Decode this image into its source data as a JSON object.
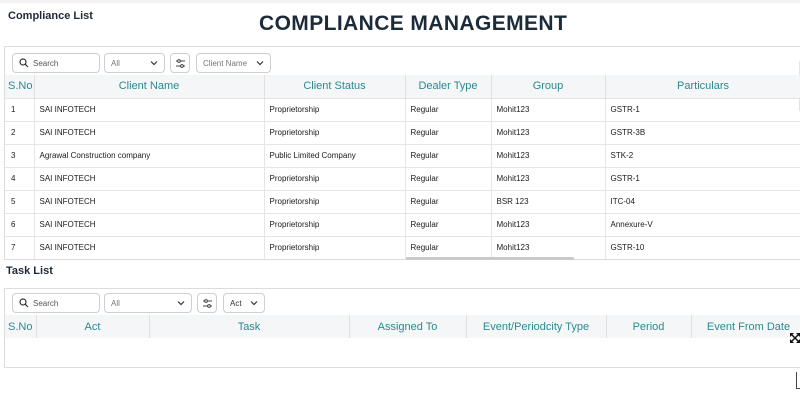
{
  "compliance": {
    "title": "Compliance List",
    "search_placeholder": "Search",
    "filter_all": "All",
    "client_filter": "Client Name",
    "columns": [
      "S.No",
      "Client Name",
      "Client Status",
      "Dealer Type",
      "Group",
      "Particulars"
    ],
    "rows": [
      [
        "1",
        "SAI INFOTECH",
        "Proprietorship",
        "Regular",
        "Mohit123",
        "GSTR-1"
      ],
      [
        "2",
        "SAI INFOTECH",
        "Proprietorship",
        "Regular",
        "Mohit123",
        "GSTR-3B"
      ],
      [
        "3",
        "Agrawal Construction company",
        "Public Limited Company",
        "Regular",
        "Mohit123",
        "STK-2"
      ],
      [
        "4",
        "SAI INFOTECH",
        "Proprietorship",
        "Regular",
        "Mohit123",
        "GSTR-1"
      ],
      [
        "5",
        "SAI INFOTECH",
        "Proprietorship",
        "Regular",
        "BSR 123",
        "ITC-04"
      ],
      [
        "6",
        "SAI INFOTECH",
        "Proprietorship",
        "Regular",
        "Mohit123",
        "Annexure-V"
      ],
      [
        "7",
        "SAI INFOTECH",
        "Proprietorship",
        "Regular",
        "Mohit123",
        "GSTR-10"
      ]
    ]
  },
  "banner": {
    "title": "COMPLIANCE MANAGEMENT"
  },
  "tasks": {
    "title": "Task List",
    "search_placeholder": "Search",
    "filter_all": "All",
    "act_filter": "Act",
    "columns": [
      "S.No",
      "Act",
      "Task",
      "Assigned To",
      "Event/Periodcity Type",
      "Period",
      "Event From Date"
    ]
  },
  "colors": {
    "header_text": "#2a8a8f",
    "header_bg": "#f4f6f8",
    "banner_text": "#1c2b3a"
  },
  "icons": [
    "search-icon",
    "chevron-down-icon",
    "filter-sliders-icon",
    "expand-arrows-icon"
  ]
}
